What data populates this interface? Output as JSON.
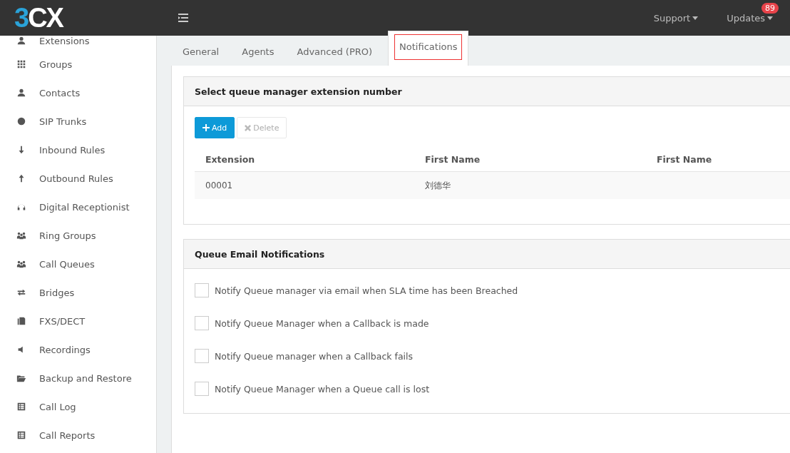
{
  "header": {
    "logo": "3CX",
    "menu": [
      {
        "label": "Support"
      },
      {
        "label": "Updates",
        "badge": "89"
      }
    ]
  },
  "sidebar": {
    "items": [
      {
        "label": "Extensions"
      },
      {
        "label": "Groups"
      },
      {
        "label": "Contacts"
      },
      {
        "label": "SIP Trunks"
      },
      {
        "label": "Inbound Rules"
      },
      {
        "label": "Outbound Rules"
      },
      {
        "label": "Digital Receptionist"
      },
      {
        "label": "Ring Groups"
      },
      {
        "label": "Call Queues"
      },
      {
        "label": "Bridges"
      },
      {
        "label": "FXS/DECT"
      },
      {
        "label": "Recordings"
      },
      {
        "label": "Backup and Restore"
      },
      {
        "label": "Call Log"
      },
      {
        "label": "Call Reports"
      }
    ]
  },
  "tabs": [
    {
      "label": "General",
      "selected": false
    },
    {
      "label": "Agents",
      "selected": false
    },
    {
      "label": "Advanced (PRO)",
      "selected": false
    },
    {
      "label": "Notifications",
      "selected": true
    }
  ],
  "manager_card": {
    "title": "Select queue manager extension number",
    "buttons": [
      {
        "label": "Add",
        "kind": "add",
        "disabled": false
      },
      {
        "label": "Delete",
        "kind": "delete",
        "disabled": true
      }
    ],
    "table": {
      "columns": [
        "Extension",
        "First Name",
        "First Name"
      ],
      "rows": [
        [
          "00001",
          "刘德华",
          ""
        ]
      ]
    }
  },
  "notifications_card": {
    "title": "Queue Email Notifications",
    "options": [
      {
        "label": "Notify Queue manager via email when SLA time has been Breached",
        "checked": false
      },
      {
        "label": "Notify Queue Manager when a Callback is made",
        "checked": false
      },
      {
        "label": "Notify Queue manager when a Callback fails",
        "checked": false
      },
      {
        "label": "Notify Queue Manager when a Queue call is lost",
        "checked": false
      }
    ]
  }
}
